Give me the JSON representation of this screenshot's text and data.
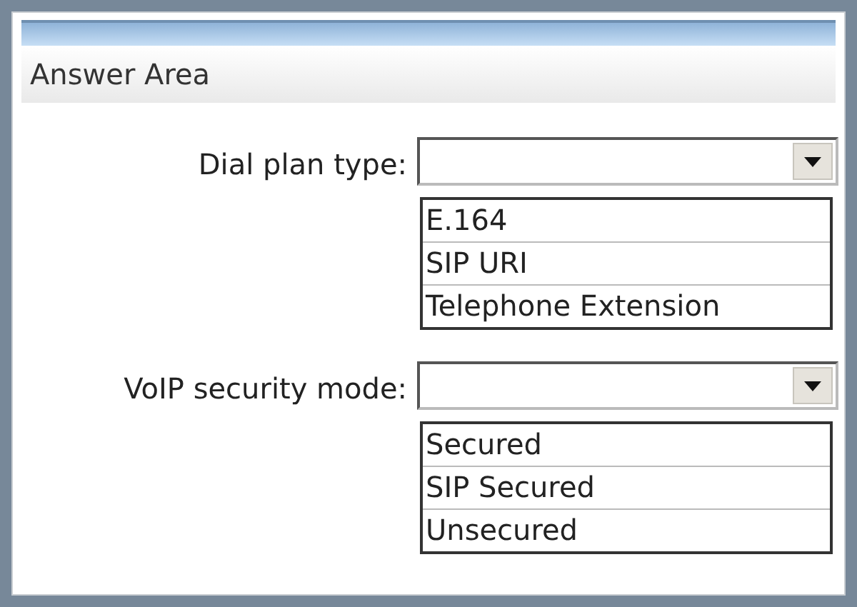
{
  "header": {
    "title": "Answer Area"
  },
  "fields": [
    {
      "label": "Dial plan type:",
      "options": [
        "E.164",
        "SIP URI",
        "Telephone Extension"
      ]
    },
    {
      "label": "VoIP security mode:",
      "options": [
        "Secured",
        "SIP Secured",
        "Unsecured"
      ]
    }
  ]
}
